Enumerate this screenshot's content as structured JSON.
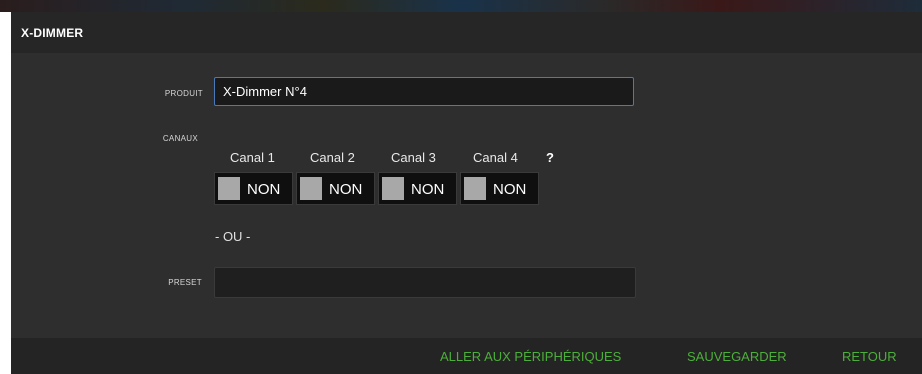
{
  "header": {
    "title": "X-DIMMER"
  },
  "form": {
    "produit_label": "PRODUIT",
    "produit_value": "X-Dimmer N°4",
    "canaux_label": "CANAUX",
    "channels": [
      {
        "label": "Canal 1",
        "state": "NON"
      },
      {
        "label": "Canal 2",
        "state": "NON"
      },
      {
        "label": "Canal 3",
        "state": "NON"
      },
      {
        "label": "Canal 4",
        "state": "NON"
      }
    ],
    "help": "?",
    "separator": "- OU -",
    "preset_label": "PRESET",
    "preset_value": ""
  },
  "footer": {
    "goto_devices": "ALLER AUX PÉRIPHÉRIQUES",
    "save": "SAUVEGARDER",
    "back": "RETOUR"
  },
  "colors": {
    "panel_bg": "#2e2e2e",
    "header_bg": "#262626",
    "accent_green": "#4caf3a",
    "input_focus_border": "#4a78b8",
    "toggle_off_knob": "#a8a8a8"
  }
}
